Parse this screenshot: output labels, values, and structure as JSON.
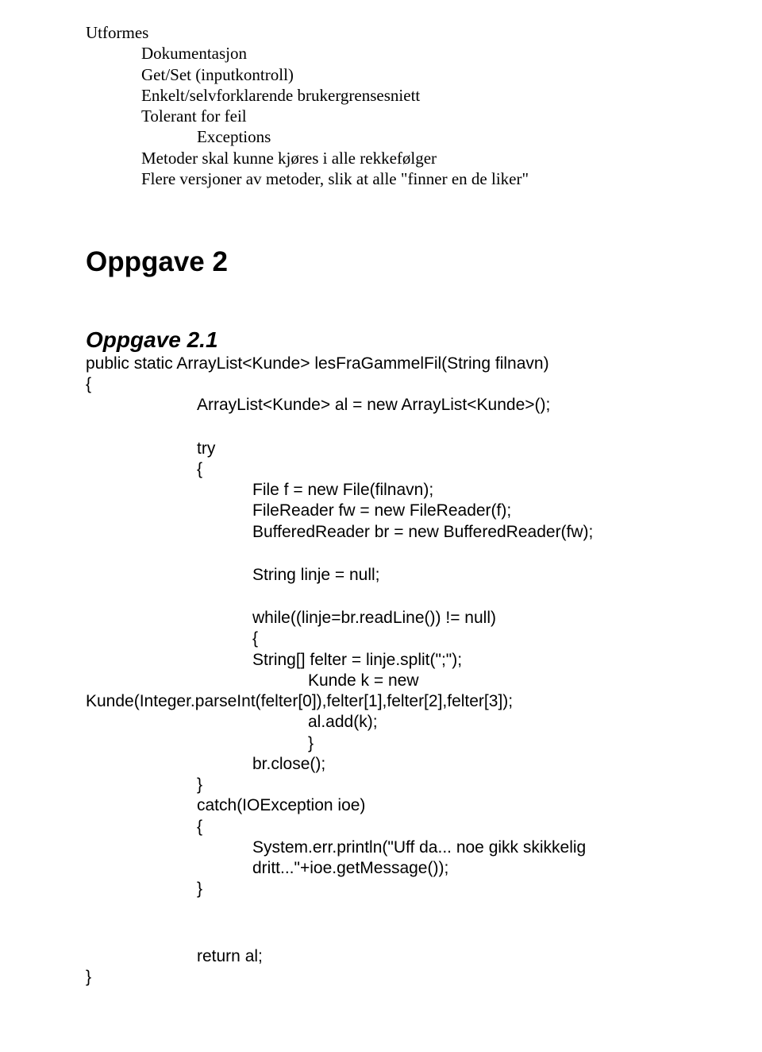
{
  "intro": {
    "l0": "Utformes",
    "l1": "Dokumentasjon",
    "l2": "Get/Set (inputkontroll)",
    "l3": "Enkelt/selvforklarende brukergrensesniett",
    "l4": "Tolerant for feil",
    "l5": "Exceptions",
    "l6": "Metoder skal kunne kjøres i alle rekkefølger",
    "l7": "Flere versjoner av metoder, slik at alle \"finner en de liker\""
  },
  "section": {
    "title": "Oppgave 2",
    "subtitle": "Oppgave 2.1"
  },
  "code": {
    "sig": "public static ArrayList<Kunde> lesFraGammelFil(String filnavn)",
    "ob": "{",
    "al": "ArrayList<Kunde> al = new ArrayList<Kunde>();",
    "try": "try",
    "ob2": "{",
    "file": "File f = new File(filnavn);",
    "reader": "FileReader fw = new FileReader(f);",
    "buffered": "BufferedReader br = new BufferedReader(fw);",
    "strnull": "String linje = null;",
    "while": "while((linje=br.readLine()) != null)",
    "ob3": "{",
    "split": "String[] felter = linje.split(\";\");",
    "kundeNew": "Kunde k = new",
    "kundeArgs": "Kunde(Integer.parseInt(felter[0]),felter[1],felter[2],felter[3]);",
    "aladd": "al.add(k);",
    "cb3": "}",
    "brclose": "br.close();",
    "cb2": "}",
    "catch": "catch(IOException ioe)",
    "ob4": "{",
    "syserr": "System.err.println(\"Uff da... noe gikk skikkelig dritt...\"+ioe.getMessage());",
    "cb4": "}",
    "ret": "return al;",
    "cb": "}"
  }
}
